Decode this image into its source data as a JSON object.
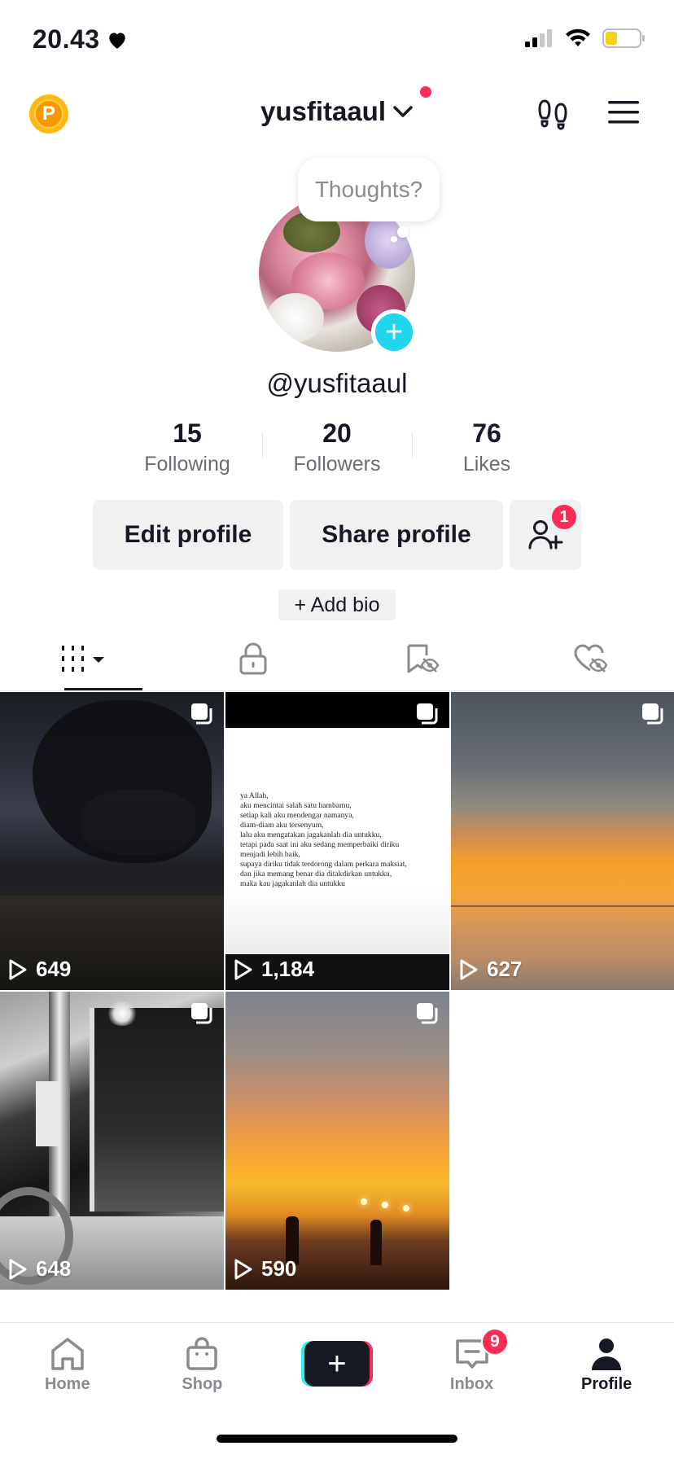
{
  "status": {
    "time": "20.43",
    "heart_icon": "heart-icon",
    "battery_color": "#f7d316"
  },
  "header": {
    "username": "yusfitaaul",
    "coin_letter": "P"
  },
  "profile": {
    "thoughts_placeholder": "Thoughts?",
    "handle": "@yusfitaaul",
    "stats": [
      {
        "value": "15",
        "label": "Following"
      },
      {
        "value": "20",
        "label": "Followers"
      },
      {
        "value": "76",
        "label": "Likes"
      }
    ],
    "edit_label": "Edit profile",
    "share_label": "Share profile",
    "friend_badge": "1",
    "add_bio_label": "+ Add bio"
  },
  "tabs": [
    "videos-grid-icon",
    "lock-icon",
    "saved-hidden-icon",
    "liked-hidden-icon"
  ],
  "videos": [
    {
      "views": "649"
    },
    {
      "views": "1,184",
      "poem": "ya Allah,\naku mencintai salah satu hambamu,\nsetiap kali aku mendengar namanya,\ndiam-diam aku tersenyum,\nlalu aku mengatakan jagakanlah dia untukku,\ntetapi pada saat ini aku sedang memperbaiki diriku\nmenjadi lebih baik,\nsupaya diriku tidak terdorong dalam perkara maksiat,\ndan jika memang benar dia ditakdirkan untukku,\nmaka kau jagakanlah dia untukku"
    },
    {
      "views": "627"
    },
    {
      "views": "648"
    },
    {
      "views": "590"
    }
  ],
  "nav": {
    "home": "Home",
    "shop": "Shop",
    "create": "+",
    "inbox": "Inbox",
    "inbox_badge": "9",
    "profile": "Profile"
  },
  "colors": {
    "accent": "#fe2c55",
    "cyan": "#25f4ee",
    "avatar_add": "#20d5ec"
  }
}
